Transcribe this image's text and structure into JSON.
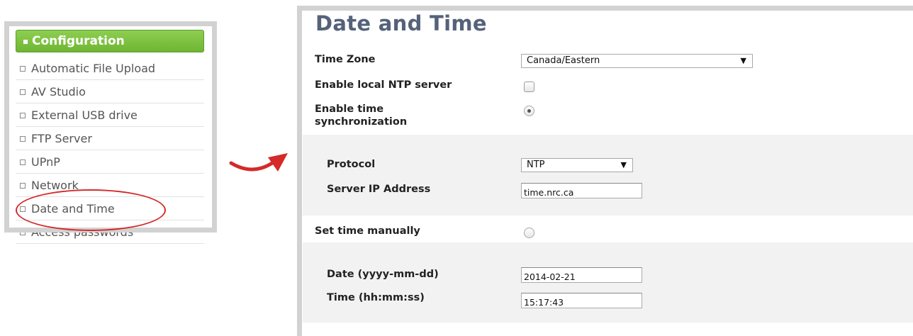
{
  "nav": {
    "header": "Configuration",
    "items": [
      {
        "label": "Automatic File Upload"
      },
      {
        "label": "AV Studio"
      },
      {
        "label": "External USB drive"
      },
      {
        "label": "FTP Server"
      },
      {
        "label": "UPnP"
      },
      {
        "label": "Network"
      },
      {
        "label": "Date and Time"
      },
      {
        "label": "Access passwords"
      }
    ]
  },
  "settings": {
    "title": "Date and Time",
    "time_zone": {
      "label": "Time Zone",
      "value": "Canada/Eastern"
    },
    "ntp_server": {
      "label": "Enable local NTP server",
      "checked": false
    },
    "time_sync": {
      "label_line1": "Enable time",
      "label_line2": "synchronization",
      "selected": true
    },
    "protocol": {
      "label": "Protocol",
      "value": "NTP"
    },
    "server_ip": {
      "label": "Server IP Address",
      "value": "time.nrc.ca"
    },
    "manual": {
      "label": "Set time manually",
      "selected": false
    },
    "date": {
      "label": "Date (yyyy-mm-dd)",
      "value": "2014-02-21"
    },
    "time": {
      "label": "Time (hh:mm:ss)",
      "value": "15:17:43"
    }
  },
  "colors": {
    "nav_header": "#7bbf3e",
    "title": "#55627a",
    "highlight": "#d42a2a",
    "panel_border": "#d2d2d2",
    "subsection_bg": "#f2f2f2"
  },
  "icons": {
    "dropdown": "triangle-down-icon",
    "arrow": "curved-arrow-icon"
  }
}
